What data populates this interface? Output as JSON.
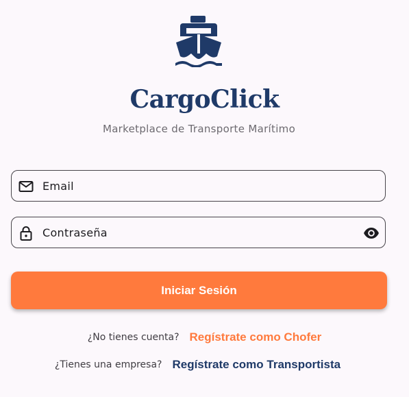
{
  "app": {
    "name": "CargoClick",
    "tagline": "Marketplace de Transporte Marítimo",
    "logo_icon": "ship-icon"
  },
  "form": {
    "email_placeholder": "Email",
    "password_placeholder": "Contraseña",
    "email_icon": "mail-icon",
    "password_icon": "lock-icon",
    "visibility_icon": "eye-icon",
    "submit_label": "Iniciar Sesión"
  },
  "register": {
    "driver_question": "¿No tienes cuenta?",
    "driver_link": "Regístrate como Chofer",
    "company_question": "¿Tienes una empresa?",
    "company_link": "Regístrate como Transportista"
  },
  "colors": {
    "primary": "#1f3a68",
    "accent": "#ff7a3d",
    "background": "#fcf8fc"
  }
}
